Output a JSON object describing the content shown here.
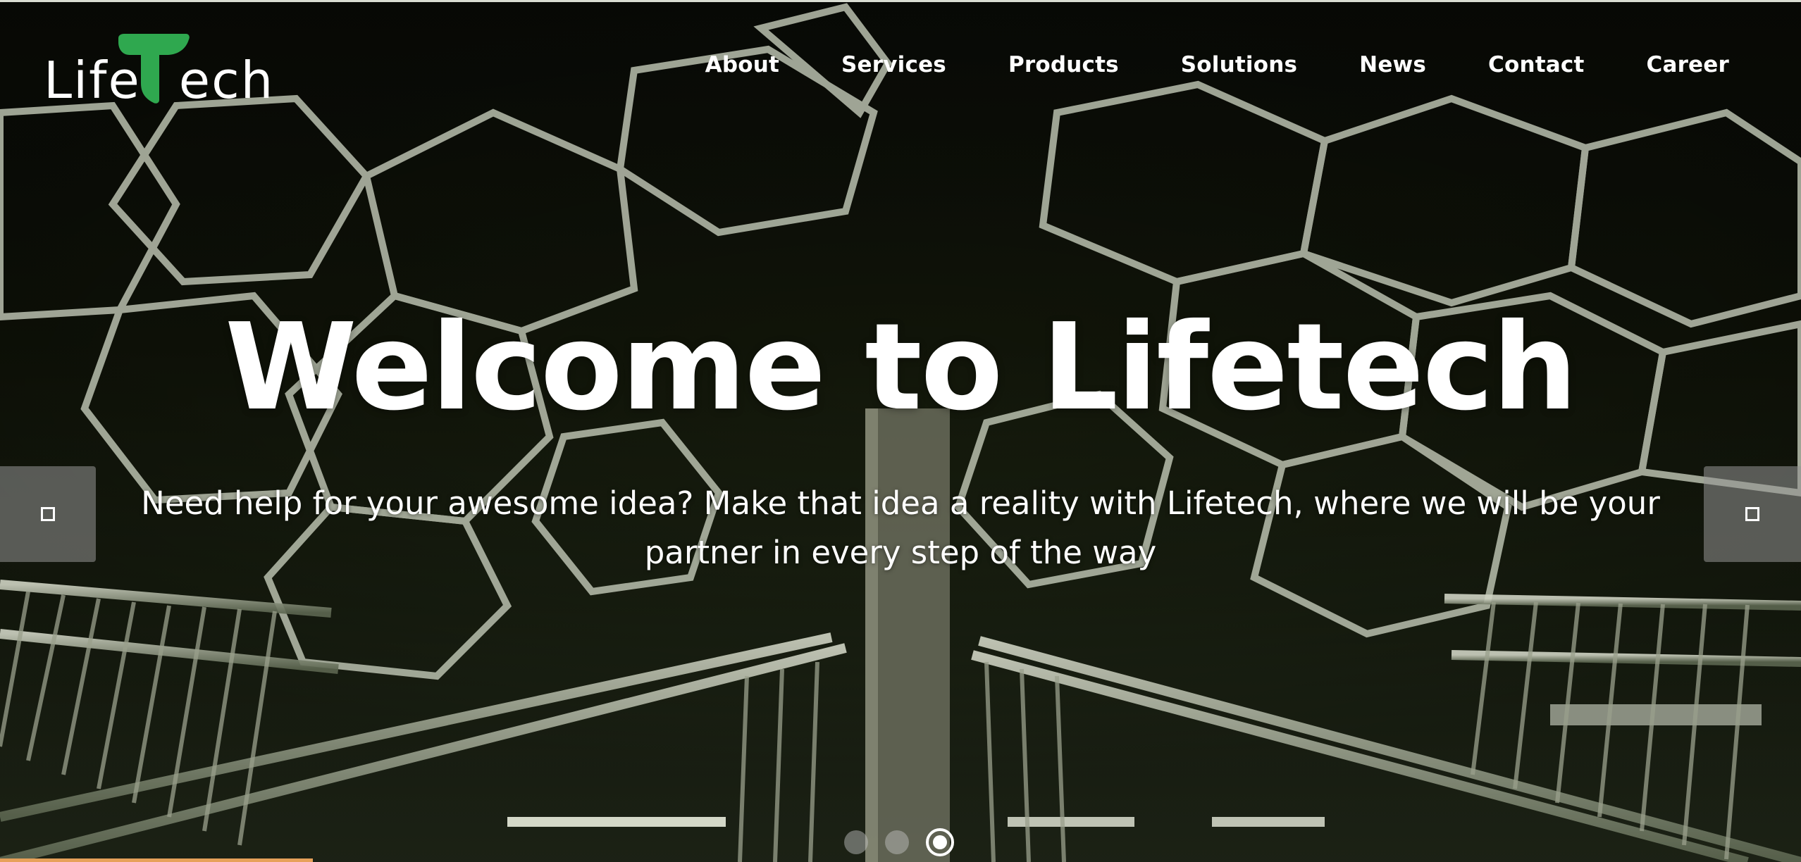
{
  "brand": {
    "logo_text_left": "Life",
    "logo_text_right": "ech",
    "logo_t_color": "#2fa84f"
  },
  "nav": {
    "items": [
      "About",
      "Services",
      "Products",
      "Solutions",
      "News",
      "Contact",
      "Career"
    ]
  },
  "hero": {
    "headline": "Welcome to Lifetech",
    "subheadline": "Need help for your awesome idea? Make that idea a reality with Lifetech, where we will be your partner in every step of the way"
  },
  "slider": {
    "prev_icon": "square-outline-icon",
    "next_icon": "square-outline-icon",
    "dot_count": 3,
    "active_index": 2
  },
  "colors": {
    "accent_green": "#2fa84f",
    "text": "#ffffff",
    "bottom_strip": "#e7a15a"
  }
}
